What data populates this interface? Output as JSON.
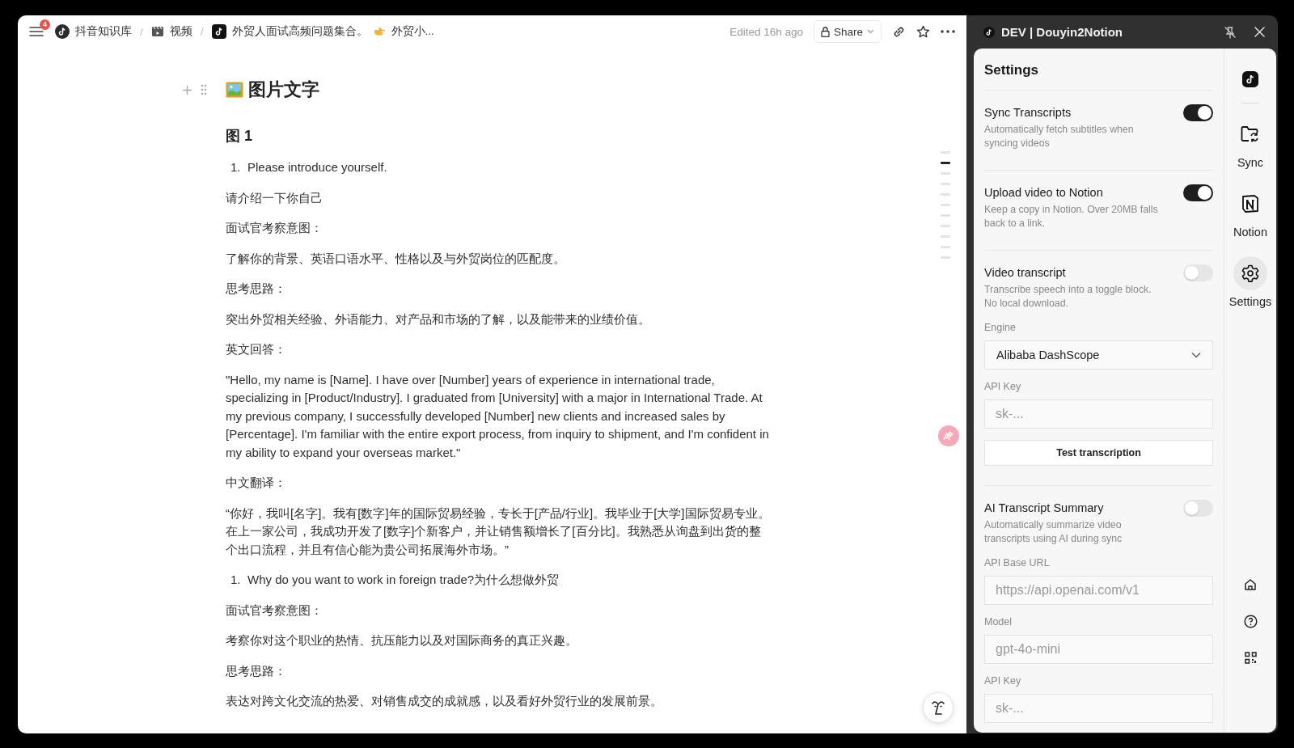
{
  "notion": {
    "header": {
      "notification_count": "4",
      "breadcrumbs": [
        {
          "kind": "workspace",
          "label": "抖音知识库"
        },
        {
          "kind": "database",
          "separator": "/",
          "label": "视频"
        },
        {
          "kind": "page",
          "separator": "/",
          "label": "外贸人面试高频问题集合。",
          "suffix": "外贸小..."
        }
      ],
      "edited": "Edited 16h ago",
      "share": "Share"
    },
    "blocks": [
      {
        "kind": "heading2",
        "text": "图片文字"
      },
      {
        "kind": "heading3",
        "text": "图 1"
      },
      {
        "kind": "numbered",
        "number": "1.",
        "text": "Please introduce yourself."
      },
      {
        "kind": "paragraph",
        "text": "请介绍一下你自己"
      },
      {
        "kind": "paragraph",
        "text": "面试官考察意图："
      },
      {
        "kind": "paragraph",
        "text": "了解你的背景、英语口语水平、性格以及与外贸岗位的匹配度。"
      },
      {
        "kind": "paragraph",
        "text": "思考思路："
      },
      {
        "kind": "paragraph",
        "text": "突出外贸相关经验、外语能力、对产品和市场的了解，以及能带来的业绩价值。"
      },
      {
        "kind": "paragraph",
        "text": "英文回答："
      },
      {
        "kind": "paragraph",
        "text": "\"Hello, my name is [Name]. I have over [Number] years of experience in international trade, specializing in [Product/Industry]. I graduated from [University] with a major in International Trade. At my previous company, I successfully developed [Number] new clients and increased sales by [Percentage]. I'm familiar with the entire export process, from inquiry to shipment, and I'm confident in my ability to expand your overseas market.\""
      },
      {
        "kind": "paragraph",
        "text": "中文翻译："
      },
      {
        "kind": "paragraph",
        "text": "“你好，我叫[名字]。我有[数字]年的国际贸易经验，专长于[产品/行业]。我毕业于[大学]国际贸易专业。在上一家公司，我成功开发了[数字]个新客户，并让销售额增长了[百分比]。我熟悉从询盘到出货的整个出口流程，并且有信心能为贵公司拓展海外市场。”"
      },
      {
        "kind": "numbered",
        "number": "1.",
        "text": "Why do you want to work in foreign trade?为什么想做外贸"
      },
      {
        "kind": "paragraph",
        "text": "面试官考察意图："
      },
      {
        "kind": "paragraph",
        "text": "考察你对这个职业的热情、抗压能力以及对国际商务的真正兴趣。"
      },
      {
        "kind": "paragraph",
        "text": "思考思路："
      },
      {
        "kind": "paragraph",
        "text": "表达对跨文化交流的热爱、对销售成交的成就感，以及看好外贸行业的发展前景。"
      }
    ],
    "outline": [
      {
        "selected": false
      },
      {
        "selected": true
      },
      {
        "selected": false
      },
      {
        "selected": false
      },
      {
        "selected": false
      },
      {
        "selected": false
      },
      {
        "selected": false
      },
      {
        "selected": false
      },
      {
        "selected": false
      },
      {
        "selected": false
      },
      {
        "selected": false
      }
    ]
  },
  "extension": {
    "title": "DEV | Douyin2Notion",
    "settings_title": "Settings",
    "sections": [
      {
        "title": "Sync Transcripts",
        "description": "Automatically fetch subtitles when syncing videos",
        "on": true
      },
      {
        "title": "Upload video to Notion",
        "description": "Keep a copy in Notion. Over 20MB falls back to a link.",
        "on": true
      },
      {
        "title": "Video transcript",
        "description": "Transcribe speech into a toggle block. No local download.",
        "on": false,
        "fields": [
          {
            "kind": "select",
            "label": "Engine",
            "value": "Alibaba DashScope"
          },
          {
            "kind": "input",
            "label": "API Key",
            "placeholder": "sk-..."
          },
          {
            "kind": "button",
            "label": "Test transcription"
          }
        ]
      },
      {
        "title": "AI Transcript Summary",
        "description": "Automatically summarize video transcripts using AI during sync",
        "on": false,
        "fields": [
          {
            "kind": "input",
            "label": "API Base URL",
            "placeholder": "https://api.openai.com/v1"
          },
          {
            "kind": "input",
            "label": "Model",
            "placeholder": "gpt-4o-mini"
          },
          {
            "kind": "input",
            "label": "API Key",
            "placeholder": "sk-..."
          }
        ]
      }
    ],
    "nav": [
      {
        "kind": "sync",
        "label": "Sync",
        "selected": false
      },
      {
        "kind": "notion",
        "label": "Notion",
        "selected": false
      },
      {
        "kind": "settings",
        "label": "Settings",
        "selected": true
      }
    ]
  }
}
